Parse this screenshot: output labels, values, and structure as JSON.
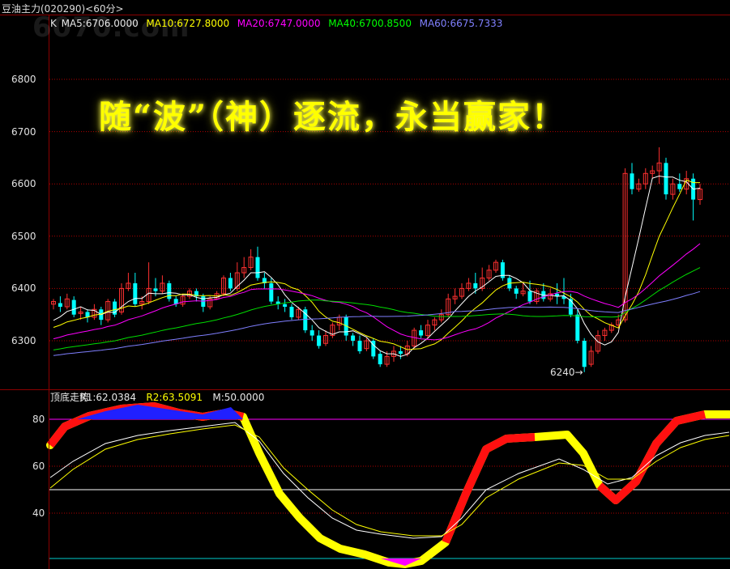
{
  "window": {
    "title": "豆油主力(020290)<60分>",
    "watermark": "6070.com"
  },
  "legend_top": [
    {
      "text": "K",
      "color": "#e8e8e8"
    },
    {
      "text": "MA5:6706.0000",
      "color": "#e8e8e8"
    },
    {
      "text": "MA10:6727.8000",
      "color": "#ffff00"
    },
    {
      "text": "MA20:6747.0000",
      "color": "#ff00ff"
    },
    {
      "text": "MA40:6700.8500",
      "color": "#00ff00"
    },
    {
      "text": "MA60:6675.7333",
      "color": "#8080ff"
    }
  ],
  "legend_bottom": [
    {
      "text": "顶底走势",
      "color": "#e8e8e8"
    },
    {
      "text": "R1:62.0384",
      "color": "#e8e8e8"
    },
    {
      "text": "R2:63.5091",
      "color": "#ffff00"
    },
    {
      "text": "M:50.0000",
      "color": "#e8e8e8"
    }
  ],
  "slogan": "随“波”（神）逐流，永当赢家！",
  "annotation": "6240→",
  "price_axis": [
    "6800",
    "6700",
    "6600",
    "6500",
    "6400",
    "6300"
  ],
  "osc_axis": [
    "80",
    "60",
    "40"
  ],
  "colors": {
    "up": "#ff3030",
    "down": "#00ffff",
    "ma5": "#ffffff",
    "ma10": "#ffff00",
    "ma20": "#ff00ff",
    "ma40": "#00dd00",
    "ma60": "#7f7fff"
  },
  "chart_data": {
    "type": "line",
    "price_ylim": [
      6220,
      6860
    ],
    "osc_ylim": [
      20,
      85
    ],
    "candles": [
      [
        6370,
        6375,
        6360,
        6380
      ],
      [
        6372,
        6365,
        6355,
        6385
      ],
      [
        6365,
        6380,
        6360,
        6390
      ],
      [
        6378,
        6350,
        6345,
        6385
      ],
      [
        6352,
        6355,
        6340,
        6365
      ],
      [
        6355,
        6345,
        6335,
        6360
      ],
      [
        6345,
        6360,
        6340,
        6370
      ],
      [
        6360,
        6340,
        6330,
        6365
      ],
      [
        6340,
        6375,
        6335,
        6380
      ],
      [
        6375,
        6350,
        6345,
        6380
      ],
      [
        6355,
        6400,
        6350,
        6410
      ],
      [
        6400,
        6410,
        6395,
        6430
      ],
      [
        6410,
        6370,
        6365,
        6430
      ],
      [
        6370,
        6375,
        6360,
        6385
      ],
      [
        6375,
        6400,
        6370,
        6450
      ],
      [
        6400,
        6395,
        6385,
        6420
      ],
      [
        6395,
        6410,
        6390,
        6425
      ],
      [
        6410,
        6380,
        6375,
        6415
      ],
      [
        6380,
        6370,
        6365,
        6385
      ],
      [
        6370,
        6385,
        6365,
        6390
      ],
      [
        6385,
        6395,
        6380,
        6400
      ],
      [
        6395,
        6385,
        6375,
        6400
      ],
      [
        6385,
        6365,
        6355,
        6390
      ],
      [
        6365,
        6380,
        6360,
        6385
      ],
      [
        6380,
        6390,
        6378,
        6395
      ],
      [
        6390,
        6420,
        6385,
        6425
      ],
      [
        6420,
        6400,
        6395,
        6430
      ],
      [
        6400,
        6430,
        6395,
        6450
      ],
      [
        6430,
        6440,
        6420,
        6460
      ],
      [
        6440,
        6460,
        6435,
        6475
      ],
      [
        6460,
        6420,
        6415,
        6480
      ],
      [
        6420,
        6410,
        6400,
        6430
      ],
      [
        6410,
        6375,
        6370,
        6420
      ],
      [
        6375,
        6370,
        6360,
        6385
      ],
      [
        6370,
        6365,
        6355,
        6380
      ],
      [
        6365,
        6345,
        6340,
        6370
      ],
      [
        6345,
        6360,
        6340,
        6365
      ],
      [
        6360,
        6320,
        6315,
        6365
      ],
      [
        6320,
        6310,
        6300,
        6330
      ],
      [
        6310,
        6290,
        6285,
        6320
      ],
      [
        6295,
        6310,
        6290,
        6320
      ],
      [
        6310,
        6330,
        6305,
        6335
      ],
      [
        6330,
        6345,
        6320,
        6350
      ],
      [
        6345,
        6310,
        6300,
        6350
      ],
      [
        6310,
        6300,
        6290,
        6315
      ],
      [
        6300,
        6280,
        6275,
        6310
      ],
      [
        6285,
        6300,
        6280,
        6305
      ],
      [
        6300,
        6270,
        6265,
        6305
      ],
      [
        6275,
        6255,
        6250,
        6280
      ],
      [
        6255,
        6270,
        6250,
        6280
      ],
      [
        6270,
        6280,
        6260,
        6290
      ],
      [
        6280,
        6275,
        6265,
        6290
      ],
      [
        6275,
        6290,
        6270,
        6300
      ],
      [
        6290,
        6320,
        6285,
        6325
      ],
      [
        6320,
        6310,
        6305,
        6330
      ],
      [
        6310,
        6330,
        6305,
        6340
      ],
      [
        6330,
        6340,
        6320,
        6345
      ],
      [
        6340,
        6350,
        6335,
        6360
      ],
      [
        6350,
        6380,
        6345,
        6390
      ],
      [
        6380,
        6385,
        6370,
        6400
      ],
      [
        6385,
        6400,
        6380,
        6410
      ],
      [
        6400,
        6410,
        6395,
        6420
      ],
      [
        6410,
        6400,
        6390,
        6430
      ],
      [
        6400,
        6420,
        6395,
        6440
      ],
      [
        6420,
        6435,
        6415,
        6445
      ],
      [
        6435,
        6450,
        6430,
        6455
      ],
      [
        6450,
        6420,
        6415,
        6455
      ],
      [
        6420,
        6400,
        6395,
        6425
      ],
      [
        6400,
        6390,
        6380,
        6405
      ],
      [
        6390,
        6395,
        6385,
        6410
      ],
      [
        6395,
        6375,
        6370,
        6415
      ],
      [
        6375,
        6395,
        6370,
        6400
      ],
      [
        6395,
        6380,
        6375,
        6410
      ],
      [
        6380,
        6390,
        6375,
        6400
      ],
      [
        6390,
        6385,
        6370,
        6410
      ],
      [
        6385,
        6380,
        6370,
        6420
      ],
      [
        6380,
        6350,
        6345,
        6390
      ],
      [
        6350,
        6300,
        6295,
        6360
      ],
      [
        6300,
        6250,
        6240,
        6305
      ],
      [
        6255,
        6280,
        6250,
        6290
      ],
      [
        6280,
        6310,
        6275,
        6320
      ],
      [
        6310,
        6320,
        6300,
        6325
      ],
      [
        6320,
        6330,
        6315,
        6335
      ],
      [
        6330,
        6340,
        6325,
        6350
      ],
      [
        6340,
        6620,
        6335,
        6630
      ],
      [
        6620,
        6590,
        6580,
        6640
      ],
      [
        6590,
        6600,
        6585,
        6610
      ],
      [
        6600,
        6620,
        6590,
        6630
      ],
      [
        6620,
        6625,
        6610,
        6635
      ],
      [
        6625,
        6640,
        6600,
        6670
      ],
      [
        6640,
        6580,
        6570,
        6650
      ],
      [
        6580,
        6600,
        6570,
        6610
      ],
      [
        6600,
        6590,
        6585,
        6620
      ],
      [
        6590,
        6610,
        6580,
        6625
      ],
      [
        6610,
        6570,
        6530,
        6620
      ],
      [
        6570,
        6590,
        6560,
        6600
      ]
    ]
  }
}
